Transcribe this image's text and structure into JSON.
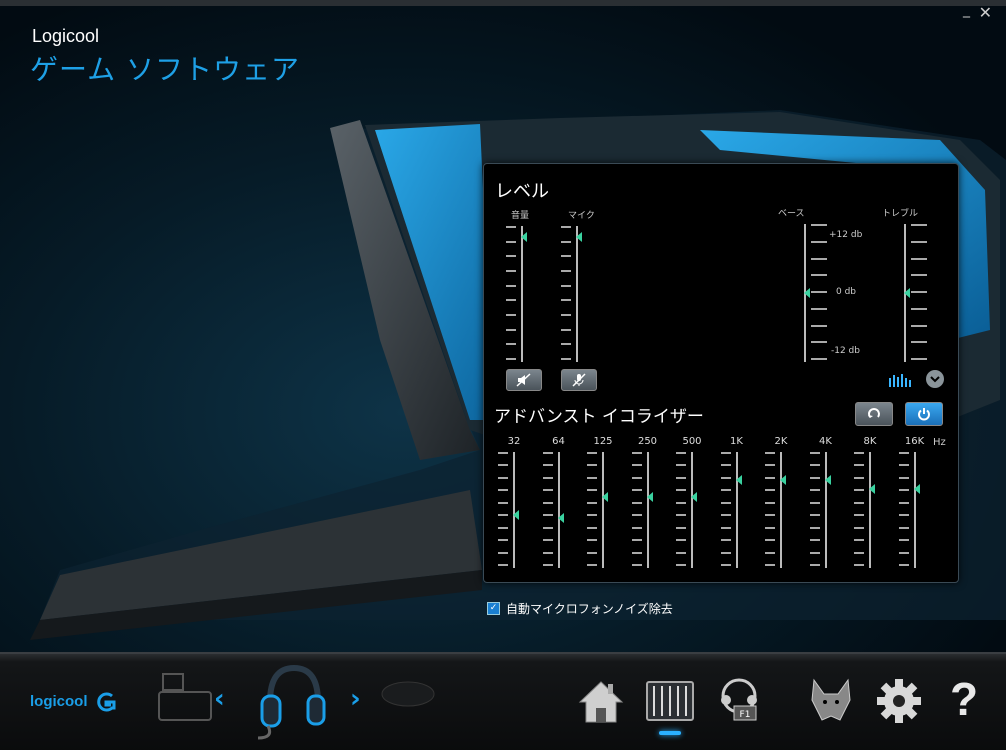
{
  "window": {
    "close_label": "✕",
    "minimize_label": "_"
  },
  "brand": "Logicool",
  "app_title": "ゲーム ソフトウェア",
  "levels": {
    "title": "レベル",
    "volume_label": "音量",
    "mic_label": "マイク",
    "bass_label": "ベース",
    "treble_label": "トレブル",
    "db_top": "+12 db",
    "db_mid": "0 db",
    "db_bottom": "-12 db"
  },
  "equalizer": {
    "title": "アドバンスト イコライザー",
    "hz_label": "Hz",
    "bands": [
      {
        "label": "32",
        "level": 0.45
      },
      {
        "label": "64",
        "level": 0.42
      },
      {
        "label": "125",
        "level": 0.62
      },
      {
        "label": "250",
        "level": 0.62
      },
      {
        "label": "500",
        "level": 0.62
      },
      {
        "label": "1K",
        "level": 0.78
      },
      {
        "label": "2K",
        "level": 0.78
      },
      {
        "label": "4K",
        "level": 0.78
      },
      {
        "label": "8K",
        "level": 0.7
      },
      {
        "label": "16K",
        "level": 0.7
      }
    ]
  },
  "noise_reduction_label": "自動マイクロフォンノイズ除去",
  "noise_reduction_checked": true,
  "bottom": {
    "logo_text": "logicool",
    "help_label": "?"
  },
  "colors": {
    "accent": "#1ea0e6",
    "knob": "#3ad2a0",
    "power": "#2a90e0"
  }
}
